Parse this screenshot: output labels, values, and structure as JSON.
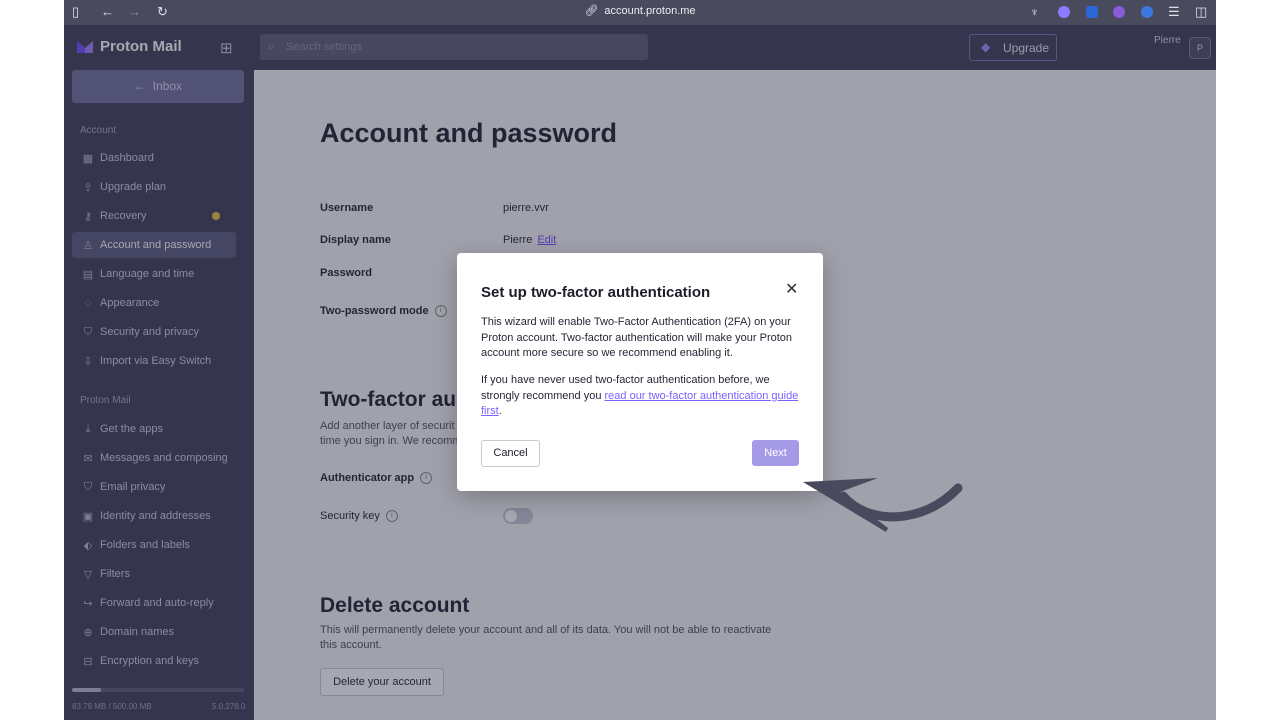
{
  "browser": {
    "url": "account.proton.me"
  },
  "header": {
    "brand": "Proton Mail",
    "search_placeholder": "Search settings",
    "upgrade_label": "Upgrade",
    "user_name": "Pierre",
    "avatar_initial": "P"
  },
  "sidebar": {
    "back_label": "Inbox",
    "account_section": "Account",
    "account_items": [
      {
        "label": "Dashboard",
        "icon": "dashboard-icon"
      },
      {
        "label": "Upgrade plan",
        "icon": "upgrade-icon"
      },
      {
        "label": "Recovery",
        "icon": "key-icon"
      },
      {
        "label": "Account and password",
        "icon": "user-icon"
      },
      {
        "label": "Language and time",
        "icon": "language-icon"
      },
      {
        "label": "Appearance",
        "icon": "palette-icon"
      },
      {
        "label": "Security and privacy",
        "icon": "shield-icon"
      },
      {
        "label": "Import via Easy Switch",
        "icon": "import-icon"
      }
    ],
    "mail_section": "Proton Mail",
    "mail_items": [
      {
        "label": "Get the apps",
        "icon": "download-icon"
      },
      {
        "label": "Messages and composing",
        "icon": "envelope-icon"
      },
      {
        "label": "Email privacy",
        "icon": "shield-icon"
      },
      {
        "label": "Identity and addresses",
        "icon": "id-card-icon"
      },
      {
        "label": "Folders and labels",
        "icon": "tag-icon"
      },
      {
        "label": "Filters",
        "icon": "filter-icon"
      },
      {
        "label": "Forward and auto-reply",
        "icon": "forward-icon"
      },
      {
        "label": "Domain names",
        "icon": "globe-icon"
      },
      {
        "label": "Encryption and keys",
        "icon": "lock-icon"
      }
    ],
    "storage_text": "83.79 MB / 500.00 MB",
    "storage_fraction": 0.17,
    "version": "5.0.278.0",
    "recovery_dot_color": "#e3c33a"
  },
  "main": {
    "title": "Account and password",
    "username_label": "Username",
    "username_value": "pierre.vvr",
    "display_name_label": "Display name",
    "display_name_value": "Pierre",
    "edit_label": "Edit",
    "password_label": "Password",
    "two_password_label": "Two-password mode",
    "twofa_title": "Two-factor au",
    "twofa_desc_line1": "Add another layer of securit",
    "twofa_desc_line2": "time you sign in. We recomm",
    "authenticator_label": "Authenticator app",
    "security_key_label": "Security key",
    "delete_title": "Delete account",
    "delete_desc": "This will permanently delete your account and all of its data. You will not be able to reactivate this account.",
    "delete_button": "Delete your account"
  },
  "modal": {
    "title": "Set up two-factor authentication",
    "paragraph1": "This wizard will enable Two-Factor Authentication (2FA) on your Proton account. Two-factor authentication will make your Proton account more secure so we recommend enabling it.",
    "paragraph2_prefix": "If you have never used two-factor authentication before, we strongly recommend you ",
    "paragraph2_link": "read our two-factor authentication guide first",
    "paragraph2_suffix": ".",
    "cancel_label": "Cancel",
    "next_label": "Next"
  },
  "colors": {
    "accent": "#6d4aff",
    "next_button": "#a49ae6",
    "sidebar_bg": "#3c3c55",
    "arrow": "#4a4a5e"
  }
}
